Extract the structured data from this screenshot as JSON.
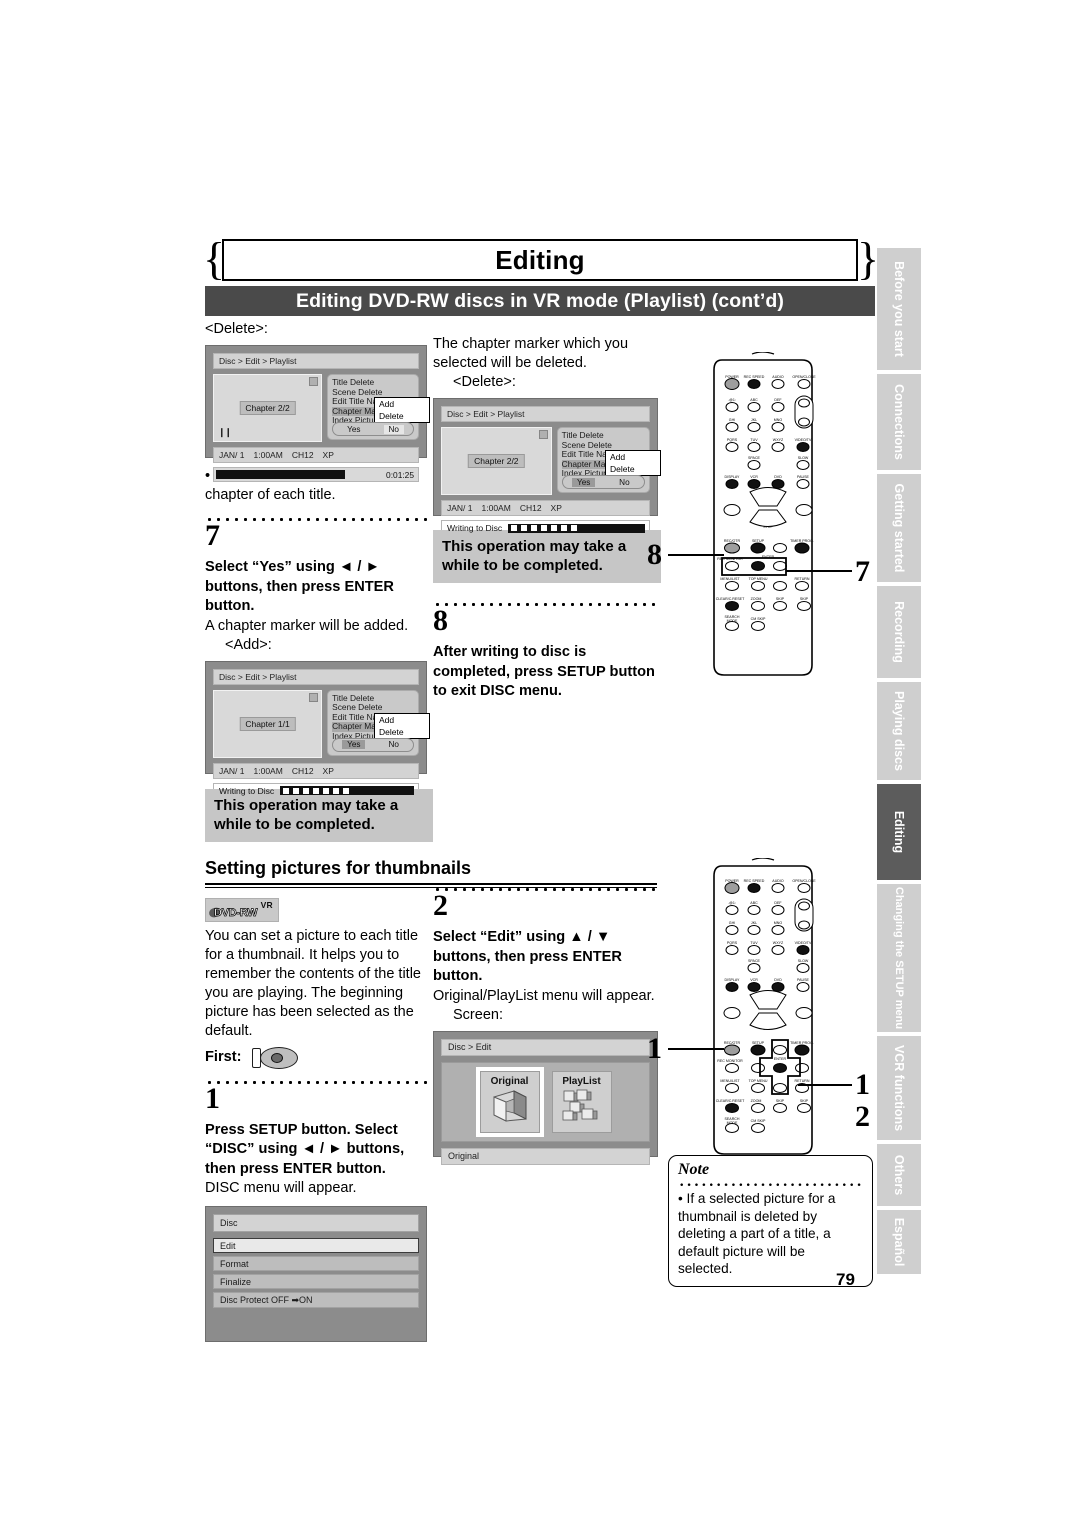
{
  "page": {
    "chapter_title": "Editing",
    "section_bar": "Editing DVD-RW discs in VR mode (Playlist) (cont’d)",
    "page_number": "79"
  },
  "side_tabs": [
    {
      "label": "Before you start",
      "active": false
    },
    {
      "label": "Connections",
      "active": false
    },
    {
      "label": "Getting started",
      "active": false
    },
    {
      "label": "Recording",
      "active": false
    },
    {
      "label": "Playing discs",
      "active": false
    },
    {
      "label": "Editing",
      "active": true
    },
    {
      "label": "Changing the SETUP menu",
      "active": false
    },
    {
      "label": "VCR functions",
      "active": false
    },
    {
      "label": "Others",
      "active": false
    },
    {
      "label": "Español",
      "active": false
    }
  ],
  "col_a": {
    "delete_label": "<Delete>:",
    "bullet_note": "• You cannot delete the first chapter of each title.",
    "step7_num": "7",
    "step7_bold": "Select “Yes” using ◄ / ► buttons, then press ENTER button.",
    "step7_body": "A chapter marker will be added.",
    "add_label": "<Add>:",
    "grey_note": "This operation may take a while to be completed.",
    "thumb_heading": "Setting pictures for thumbnails",
    "badge": {
      "vr": "VR",
      "name": "DVD-RW"
    },
    "thumb_body": "You can set a picture to each title for a thumbnail. It helps you to remember the contents of the title you are playing. The beginning picture has been selected as the default.",
    "first_label": "First:",
    "step1_num": "1",
    "step1_bold": "Press SETUP button. Select “DISC” using ◄ / ► buttons, then press ENTER button.",
    "step1_body": "DISC menu will appear."
  },
  "col_b": {
    "intro": "The chapter marker which you selected will be deleted.",
    "delete_label": "<Delete>:",
    "grey_note": "This operation may take a while to be completed.",
    "step8_num": "8",
    "step8_bold": "After writing to disc is completed, press SETUP button to exit DISC menu.",
    "step2_num": "2",
    "step2_bold": "Select “Edit” using ▲ / ▼ buttons, then press ENTER button.",
    "step2_body": "Original/PlayList menu will appear.",
    "screen_label": "Screen:"
  },
  "tv_screens": {
    "playlist_delete_1": {
      "breadcrumb": "Disc > Edit > Playlist",
      "chapter": "Chapter 2/2",
      "menu": [
        "Title Delete",
        "Scene Delete",
        "Edit Title Name",
        "Chapter Mark",
        "Index Picture"
      ],
      "menu_selected_index": 3,
      "popup": [
        "Add",
        "Delete"
      ],
      "popup_selected": "Delete",
      "yes": "Yes",
      "no": "No",
      "yesno_highlight": "No",
      "info": [
        "JAN/ 1",
        "1:00AM",
        "CH12",
        "XP"
      ],
      "time": "0:01:25",
      "writing": null
    },
    "playlist_delete_2": {
      "breadcrumb": "Disc > Edit > Playlist",
      "chapter": "Chapter 2/2",
      "menu": [
        "Title Delete",
        "Scene Delete",
        "Edit Title Name",
        "Chapter Mark",
        "Index Picture"
      ],
      "menu_selected_index": 3,
      "popup": [
        "Add",
        "Delete"
      ],
      "popup_selected": "Delete",
      "yes": "Yes",
      "no": "No",
      "yesno_highlight": "Yes",
      "info": [
        "JAN/ 1",
        "1:00AM",
        "CH12",
        "XP"
      ],
      "writing": "Writing to Disc"
    },
    "playlist_add": {
      "breadcrumb": "Disc > Edit > Playlist",
      "chapter": "Chapter 1/1",
      "menu": [
        "Title Delete",
        "Scene Delete",
        "Edit Title Name",
        "Chapter Mark",
        "Index Picture"
      ],
      "menu_selected_index": 3,
      "popup": [
        "Add",
        "Delete"
      ],
      "popup_selected": "Add",
      "yes": "Yes",
      "no": "No",
      "yesno_highlight": "Yes",
      "info": [
        "JAN/ 1",
        "1:00AM",
        "CH12",
        "XP"
      ],
      "writing": "Writing to Disc"
    },
    "disc_menu": {
      "title": "Disc",
      "items": [
        "Edit",
        "Format",
        "Finalize",
        "Disc Protect OFF ➡ON"
      ],
      "selected_index": 0
    },
    "original_playlist": {
      "breadcrumb": "Disc > Edit",
      "tiles": [
        "Original",
        "PlayList"
      ],
      "selected_tile": "Original",
      "footer": "Original"
    }
  },
  "remotes": {
    "top": {
      "callout_setup": "8",
      "callout_arrows": "7",
      "rows": {
        "r1": [
          "POWER",
          "REC SPEED",
          "AUDIO",
          "OPEN/CLOSE"
        ],
        "r2_sub": [
          ".@1:",
          "ABC",
          "DEF"
        ],
        "r2": [
          "1",
          "2",
          "3"
        ],
        "r3_sub": [
          "GHI",
          "JKL",
          "MNO"
        ],
        "r3": [
          "4",
          "5",
          "6"
        ],
        "r4_sub": [
          "PQRS",
          "TUV",
          "WXYZ",
          "VIDEO/TV"
        ],
        "r4": [
          "7",
          "8",
          "9"
        ],
        "r5_sub": [
          "SPACE",
          "SLOW"
        ],
        "r5": [
          "0"
        ],
        "r6": [
          "DISPLAY",
          "VCR",
          "DVD",
          "PAUSE"
        ],
        "ch": "CH",
        "play": "PLAY",
        "stop": "STOP",
        "r7": [
          "REC/OTR",
          "SETUP",
          "TIMER PROG."
        ],
        "r8": [
          "REC MONITOR",
          "ENTER"
        ],
        "r9": [
          "MENU/LIST",
          "TOP MENU",
          "RETURN"
        ],
        "r10": [
          "CLEAR/C.RESET",
          "ZOOM",
          "SKIP",
          "SKIP"
        ],
        "r11": [
          "SEARCH MODE",
          "CM SKIP"
        ]
      }
    },
    "bottom": {
      "callout_setup": "1",
      "callout_arrows": "1",
      "callout_enter": "2"
    }
  },
  "note": {
    "title": "Note",
    "body": "• If a selected picture for a thumbnail is deleted by deleting a part of a title, a default picture will be selected."
  }
}
